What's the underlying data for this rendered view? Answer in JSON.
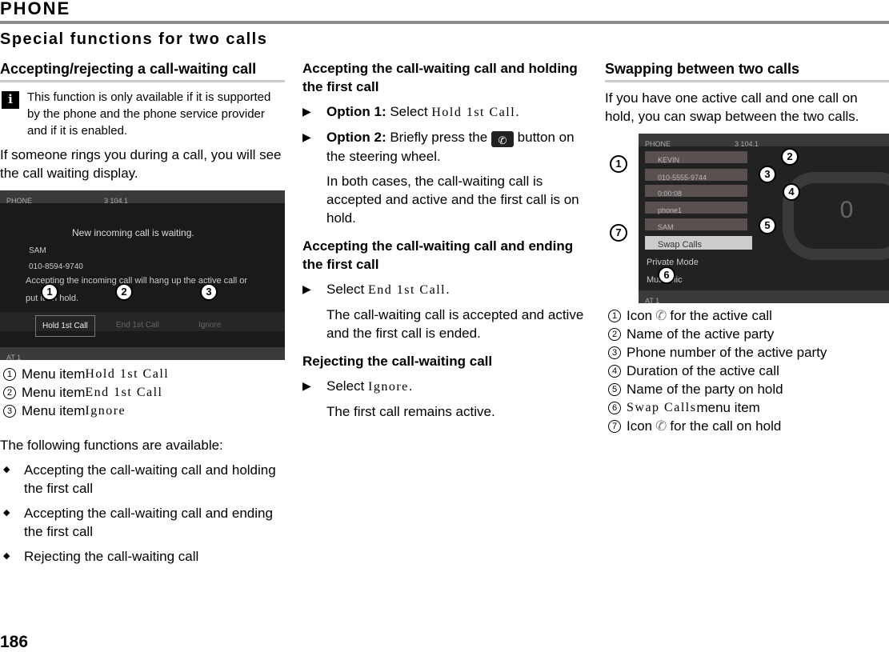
{
  "header": {
    "chapter": "PHONE",
    "section": "Special functions for two calls",
    "page_number": "186"
  },
  "col1": {
    "title": "Accepting/rejecting a call-waiting call",
    "note": "This function is only available if it is supported by the phone and the phone service provider and if it is enabled.",
    "intro": "If someone rings you during a call, you will see the call waiting display.",
    "screen": {
      "title": "PHONE",
      "status": "3 104.1",
      "message": "New incoming call is waiting.",
      "name": "SAM",
      "number": "010-8594-9740",
      "warning": "Accepting the incoming call will hang up the active call or put it on hold.",
      "buttons": [
        "Hold 1st Call",
        "End 1st Call",
        "Ignore"
      ],
      "footer": "AT 1"
    },
    "legend": [
      {
        "n": "1",
        "prefix": "Menu item ",
        "item": "Hold 1st Call"
      },
      {
        "n": "2",
        "prefix": "Menu item ",
        "item": "End 1st Call"
      },
      {
        "n": "3",
        "prefix": "Menu item ",
        "item": "Ignore"
      }
    ],
    "available": "The following functions are available:",
    "bullets": [
      "Accepting the call-waiting call and holding the first call",
      "Accepting the call-waiting call and ending the first call",
      "Rejecting the call-waiting call"
    ]
  },
  "col2": {
    "s1_title": "Accepting the call-waiting call and holding the first call",
    "opt1_label": "Option 1:",
    "opt1_text": " Select ",
    "opt1_item": "Hold 1st Call",
    "opt1_end": ".",
    "opt2_label": "Option 2:",
    "opt2_text": " Briefly press the ",
    "opt2_end": " button on the steering wheel.",
    "s1_result": "In both cases, the call-waiting call is accepted and active and the first call is on hold.",
    "s2_title": "Accepting the call-waiting call and ending the first call",
    "s2_text": "Select ",
    "s2_item": "End 1st Call",
    "s2_end": ".",
    "s2_result": "The call-waiting call is accepted and active and the first call is ended.",
    "s3_title": "Rejecting the call-waiting call",
    "s3_text": "Select ",
    "s3_item": "Ignore",
    "s3_end": ".",
    "s3_result": "The first call remains active."
  },
  "col3": {
    "title": "Swapping between two calls",
    "intro": "If you have one active call and one call on hold, you can swap between the two calls.",
    "screen": {
      "title": "PHONE",
      "status": "3 104.1",
      "rows": [
        "KEVIN",
        "010-5555-9744",
        "0:00:08",
        "phone1",
        "SAM"
      ],
      "menu": [
        "Swap Calls",
        "Private Mode",
        "Mute Mic"
      ],
      "counter": "0",
      "footer": "AT 1"
    },
    "legend": [
      {
        "n": "1",
        "pre": "Icon ",
        "item": "",
        "post": " for the active call",
        "icon": "phone-active-icon"
      },
      {
        "n": "2",
        "pre": "Name of the active party"
      },
      {
        "n": "3",
        "pre": "Phone number of the active party"
      },
      {
        "n": "4",
        "pre": "Duration of the active call"
      },
      {
        "n": "5",
        "pre": "Name of the party on hold"
      },
      {
        "n": "6",
        "pre": "",
        "item": "Swap Calls",
        "post": " menu item"
      },
      {
        "n": "7",
        "pre": "Icon ",
        "item": "",
        "post": " for the call on hold",
        "icon": "phone-hold-icon"
      }
    ]
  }
}
